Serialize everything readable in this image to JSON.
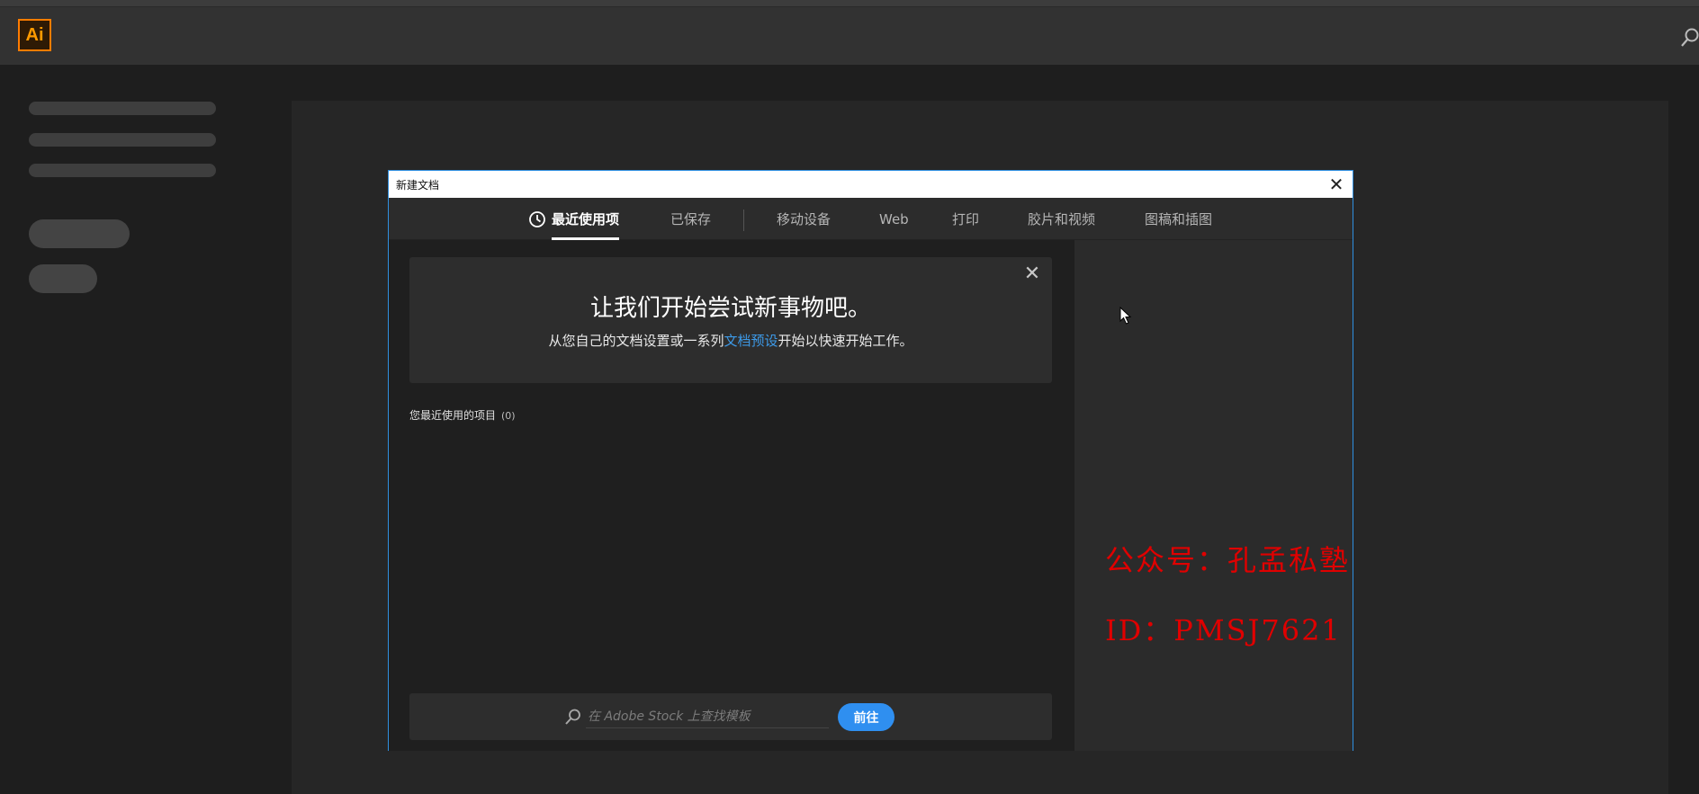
{
  "app": {
    "logo_text": "Ai",
    "logo_color": "#ff7c00",
    "search_icon": "search-icon"
  },
  "dialog": {
    "title": "新建文档",
    "close_glyph": "✕",
    "accent_color": "#2f8fe0",
    "tabs": [
      {
        "label": "最近使用项",
        "active": true,
        "icon": "clock-icon"
      },
      {
        "label": "已保存"
      },
      {
        "label": "移动设备"
      },
      {
        "label": "Web"
      },
      {
        "label": "打印"
      },
      {
        "label": "胶片和视频"
      },
      {
        "label": "图稿和插图"
      }
    ],
    "welcome": {
      "close_glyph": "✕",
      "title": "让我们开始尝试新事物吧。",
      "subtitle_before": "从您自己的文档设置或一系列",
      "subtitle_link": "文档预设",
      "subtitle_after": "开始以快速开始工作。"
    },
    "recent": {
      "label": "您最近使用的项目",
      "count": "(0)"
    },
    "stock": {
      "placeholder": "在 Adobe Stock 上查找模板",
      "go_label": "前往",
      "go_color": "#2f8ff0"
    }
  },
  "watermark": {
    "line1": "公众号：孔孟私塾",
    "line2": "ID：PMSJ7621",
    "color": "#e00000"
  }
}
